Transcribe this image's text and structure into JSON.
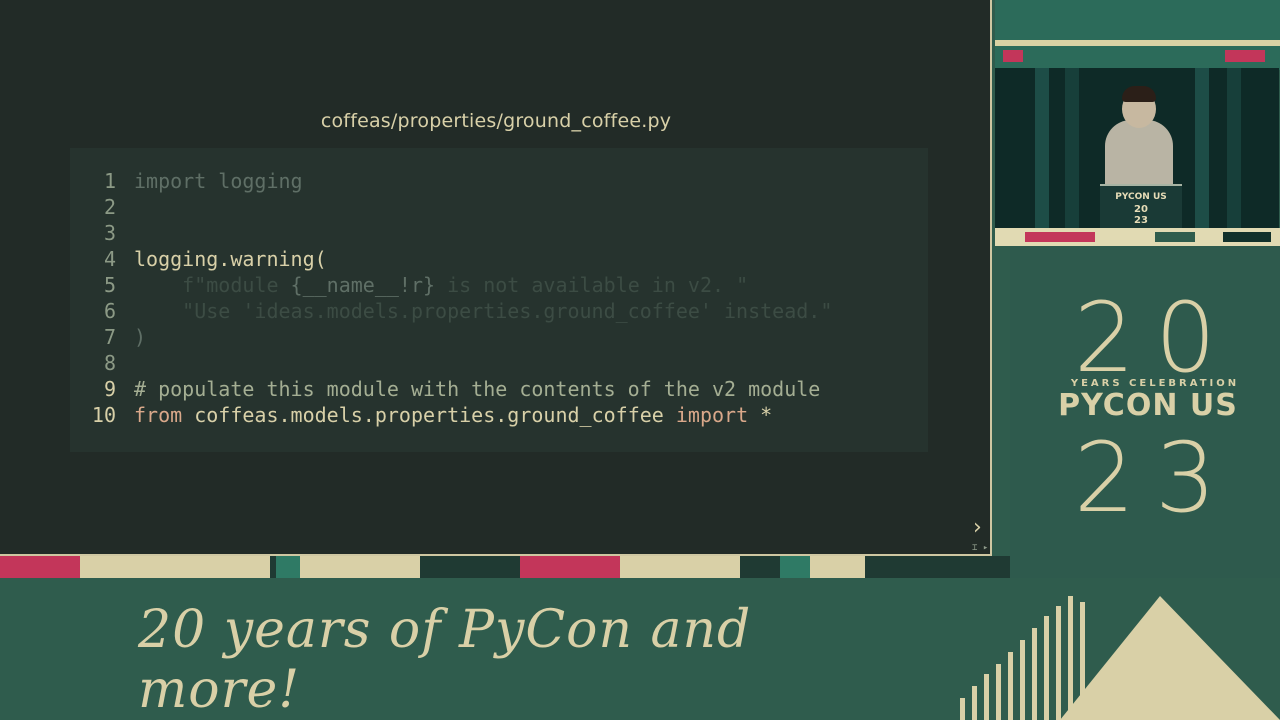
{
  "slide": {
    "title": "coffeas/properties/ground_coffee.py",
    "code": [
      {
        "num": "1",
        "parts": [
          {
            "c": "tok-dim",
            "t": "import logging"
          }
        ]
      },
      {
        "num": "2",
        "parts": []
      },
      {
        "num": "3",
        "parts": []
      },
      {
        "num": "4",
        "parts": [
          {
            "c": "tok-txt",
            "t": "logging.warning("
          }
        ]
      },
      {
        "num": "5",
        "parts": [
          {
            "c": "tok-faint",
            "t": "    f\"module "
          },
          {
            "c": "tok-dim",
            "t": "{__name__!r}"
          },
          {
            "c": "tok-faint",
            "t": " is not available in v2. \""
          }
        ]
      },
      {
        "num": "6",
        "parts": [
          {
            "c": "tok-faint",
            "t": "    \"Use 'ideas.models.properties.ground_coffee' instead.\""
          }
        ]
      },
      {
        "num": "7",
        "parts": [
          {
            "c": "tok-dim",
            "t": ")"
          }
        ]
      },
      {
        "num": "8",
        "parts": []
      },
      {
        "num": "9",
        "parts": [
          {
            "c": "tok-comment",
            "t": "# populate this module with the contents of the v2 module"
          }
        ]
      },
      {
        "num": "10",
        "parts": [
          {
            "c": "tok-kw",
            "t": "from"
          },
          {
            "c": "tok-txt",
            "t": " coffeas.models.properties.ground_coffee "
          },
          {
            "c": "tok-kw",
            "t": "import"
          },
          {
            "c": "tok-txt",
            "t": " *"
          }
        ]
      }
    ],
    "next_label": "›",
    "footer_icons": "⌶ ▸"
  },
  "video": {
    "podium_brand": "PYCON US",
    "podium_year_top": "20",
    "podium_year_bottom": "23"
  },
  "logo": {
    "digits_top": "20",
    "years_label": "YEARS CELEBRATION",
    "brand": "PYCON US",
    "digits_bottom": "23"
  },
  "tagline": "20 years of PyCon and more!",
  "colors": {
    "cream": "#d9d0a7",
    "green_bg": "#2f5c4d",
    "slide_bg": "#222b27",
    "pink_accent": "#c3365a"
  }
}
